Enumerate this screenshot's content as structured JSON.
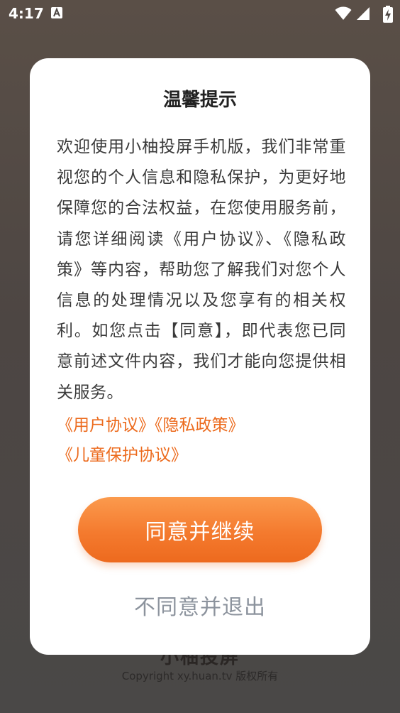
{
  "status_bar": {
    "time": "4:17",
    "notification_icon": "a-text-icon",
    "wifi_icon": "wifi-icon",
    "signal_icon": "signal-icon",
    "battery_icon": "battery-charging-icon"
  },
  "background": {
    "app_name": "小柚投屏",
    "copyright": "Copyright xy.huan.tv 版权所有"
  },
  "dialog": {
    "title": "温馨提示",
    "body": "欢迎使用小柚投屏手机版，我们非常重视您的个人信息和隐私保护，为更好地保障您的合法权益，在您使用服务前，请您详细阅读《用户协议》、《隐私政策》等内容，帮助您了解我们对您个人信息的处理情况以及您享有的相关权利。如您点击【同意】，即代表您已同意前述文件内容，我们才能向您提供相关服务。",
    "links": {
      "user_agreement": "《用户协议》",
      "privacy_policy": "《隐私政策》",
      "child_protection": "《儿童保护协议》"
    },
    "agree_label": "同意并继续",
    "disagree_label": "不同意并退出"
  },
  "colors": {
    "accent": "#f47a2e",
    "link": "#ec6a1c",
    "secondary_text": "#8c939d"
  }
}
